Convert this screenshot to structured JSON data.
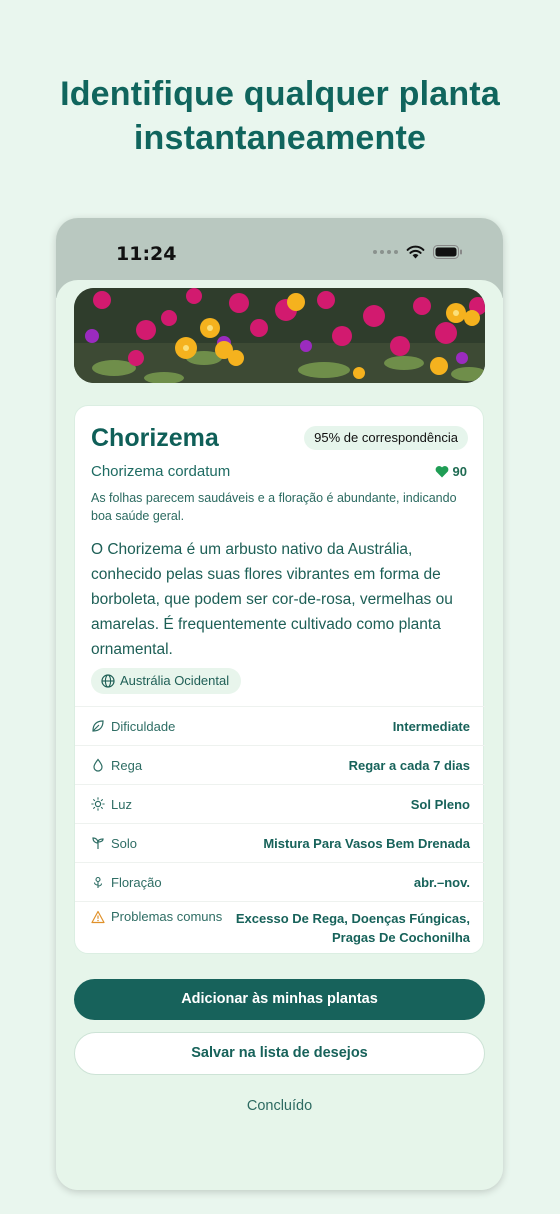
{
  "headline": {
    "line1": "Identifique qualquer planta",
    "line2": "instantaneamente"
  },
  "status_bar": {
    "time": "11:24"
  },
  "plant": {
    "name": "Chorizema",
    "match_badge": "95% de correspondência",
    "scientific_name": "Chorizema cordatum",
    "health_score": "90",
    "health_note": "As folhas parecem saudáveis e a floração é abundante, indicando boa saúde geral.",
    "description": "O Chorizema é um arbusto nativo da Austrália, conhecido pelas suas flores vibrantes em forma de borboleta, que podem ser cor-de-rosa, vermelhas ou amarelas. É frequentemente cultivado como planta ornamental.",
    "region": "Austrália Ocidental"
  },
  "details": [
    {
      "icon": "leaf-icon",
      "label": "Dificuldade",
      "value": "Intermediate"
    },
    {
      "icon": "water-drop-icon",
      "label": "Rega",
      "value": "Regar a cada 7 dias"
    },
    {
      "icon": "sun-icon",
      "label": "Luz",
      "value": "Sol Pleno"
    },
    {
      "icon": "sprout-icon",
      "label": "Solo",
      "value": "Mistura Para Vasos Bem Drenada"
    },
    {
      "icon": "flower-icon",
      "label": "Floração",
      "value": "abr.–nov."
    },
    {
      "icon": "warning-icon",
      "label": "Problemas comuns",
      "value_line1": "Excesso De Rega, Doenças Fúngicas,",
      "value_line2": "Pragas De Cochonilha"
    }
  ],
  "actions": {
    "add": "Adicionar às minhas plantas",
    "wishlist": "Salvar na lista de desejos",
    "done": "Concluído"
  },
  "colors": {
    "primary": "#17625b",
    "background": "#e9f6ee",
    "heart": "#1f9d55",
    "warning": "#e0912a"
  }
}
